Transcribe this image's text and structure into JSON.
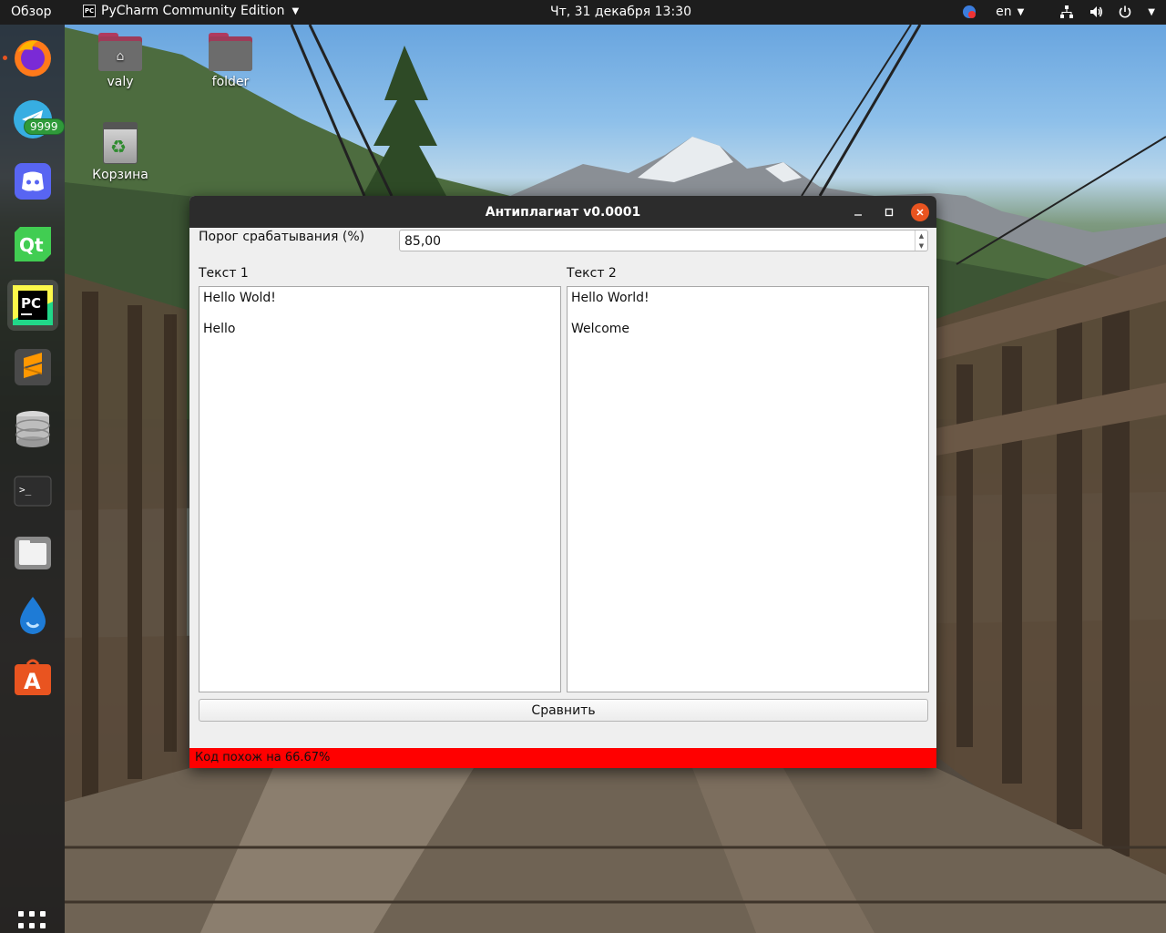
{
  "topbar": {
    "activities": "Обзор",
    "app_name": "PyCharm Community Edition",
    "clock": "Чт, 31 декабря  13:30",
    "lang": "en"
  },
  "dock": {
    "items": [
      "firefox-icon",
      "telegram-icon",
      "discord-icon",
      "qt-creator-icon",
      "pycharm-icon",
      "sublime-text-icon",
      "database-icon",
      "terminal-icon",
      "files-icon",
      "drop-icon",
      "software-center-icon"
    ],
    "telegram_badge": "9999",
    "active": "pycharm-icon"
  },
  "desktop": {
    "icons": [
      {
        "label": "valy",
        "icon": "home-folder-icon"
      },
      {
        "label": "folder",
        "icon": "folder-icon"
      },
      {
        "label": "Корзина",
        "icon": "trash-icon"
      }
    ]
  },
  "window": {
    "title": "Антиплагиат v0.0001",
    "threshold_label": "Порог срабатывания (%)",
    "threshold_value": "85,00",
    "text1_label": "Текст 1",
    "text2_label": "Текст 2",
    "text1_lines": [
      "Hello Wold!",
      "",
      "Hello"
    ],
    "text2_lines": [
      "Hello World!",
      "",
      "Welcome"
    ],
    "compare_button": "Сравнить",
    "status": "Код похож на 66.67%",
    "status_color": "#ff0000"
  }
}
